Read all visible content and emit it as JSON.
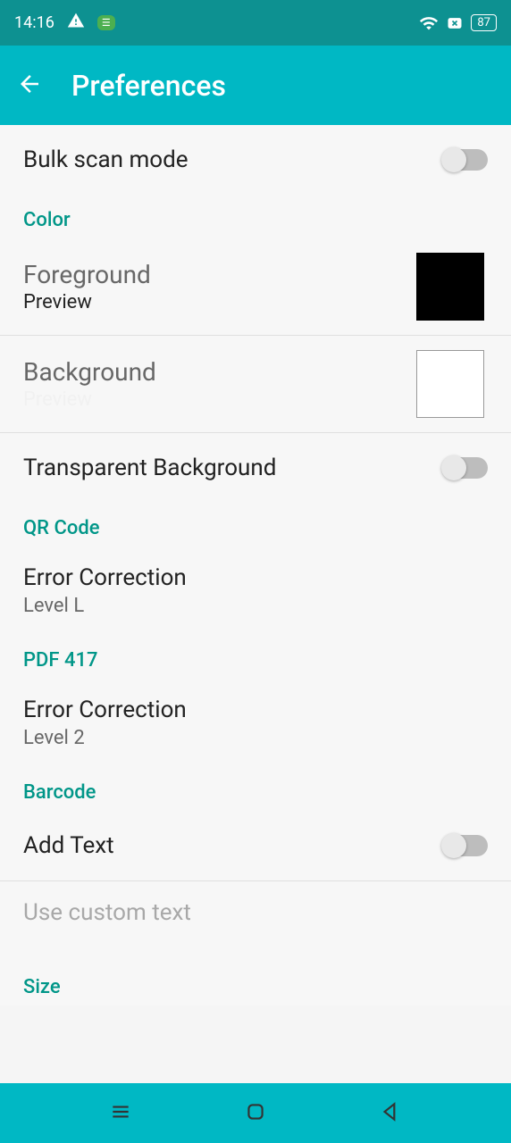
{
  "status": {
    "time": "14:16",
    "battery": "87"
  },
  "appBar": {
    "title": "Preferences"
  },
  "bulkScan": {
    "label": "Bulk scan mode"
  },
  "color": {
    "header": "Color",
    "foreground": {
      "title": "Foreground",
      "subtitle": "Preview"
    },
    "background": {
      "title": "Background",
      "subtitle": "Preview"
    },
    "transparent": {
      "label": "Transparent Background"
    }
  },
  "qrCode": {
    "header": "QR Code",
    "errorCorrection": {
      "title": "Error Correction",
      "value": "Level L"
    }
  },
  "pdf417": {
    "header": "PDF 417",
    "errorCorrection": {
      "title": "Error Correction",
      "value": "Level 2"
    }
  },
  "barcode": {
    "header": "Barcode",
    "addText": {
      "label": "Add Text"
    },
    "customText": {
      "label": "Use custom text"
    }
  },
  "size": {
    "header": "Size"
  }
}
